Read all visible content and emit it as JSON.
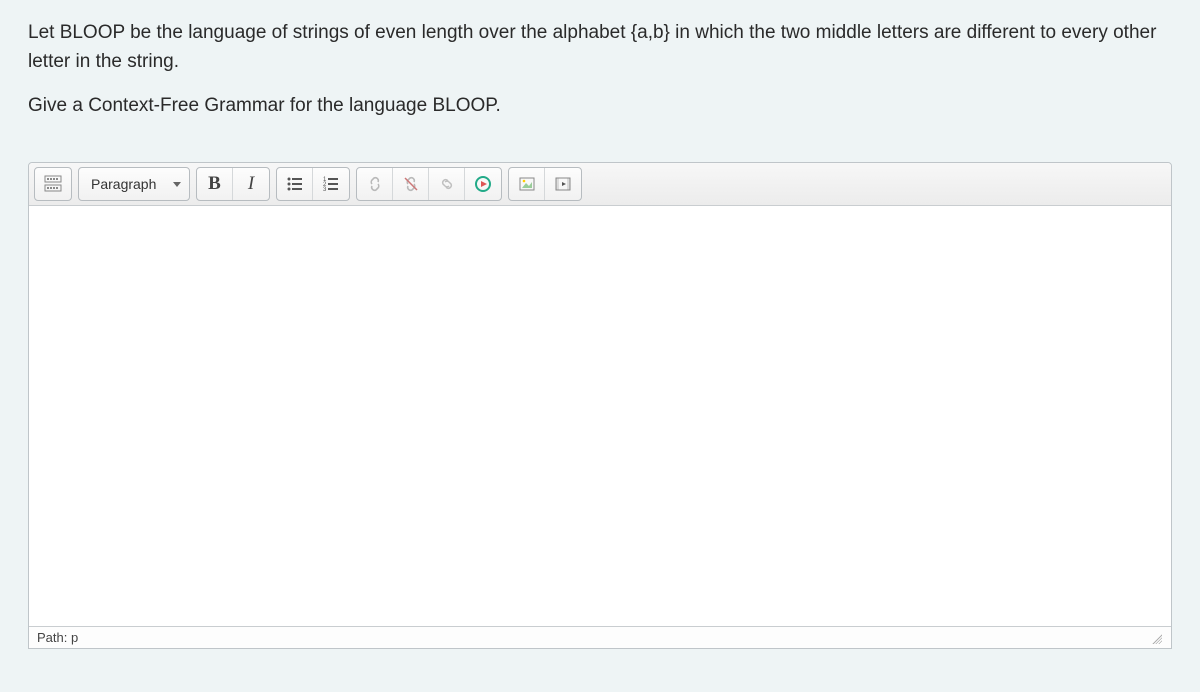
{
  "question": {
    "line1": "Let BLOOP be the language of strings of even length over the alphabet {a,b} in which the two middle letters are different to every other letter in the string.",
    "line2": "Give a Context-Free Grammar for the language BLOOP."
  },
  "toolbar": {
    "format_label": "Paragraph"
  },
  "statusbar": {
    "path": "Path: p"
  }
}
